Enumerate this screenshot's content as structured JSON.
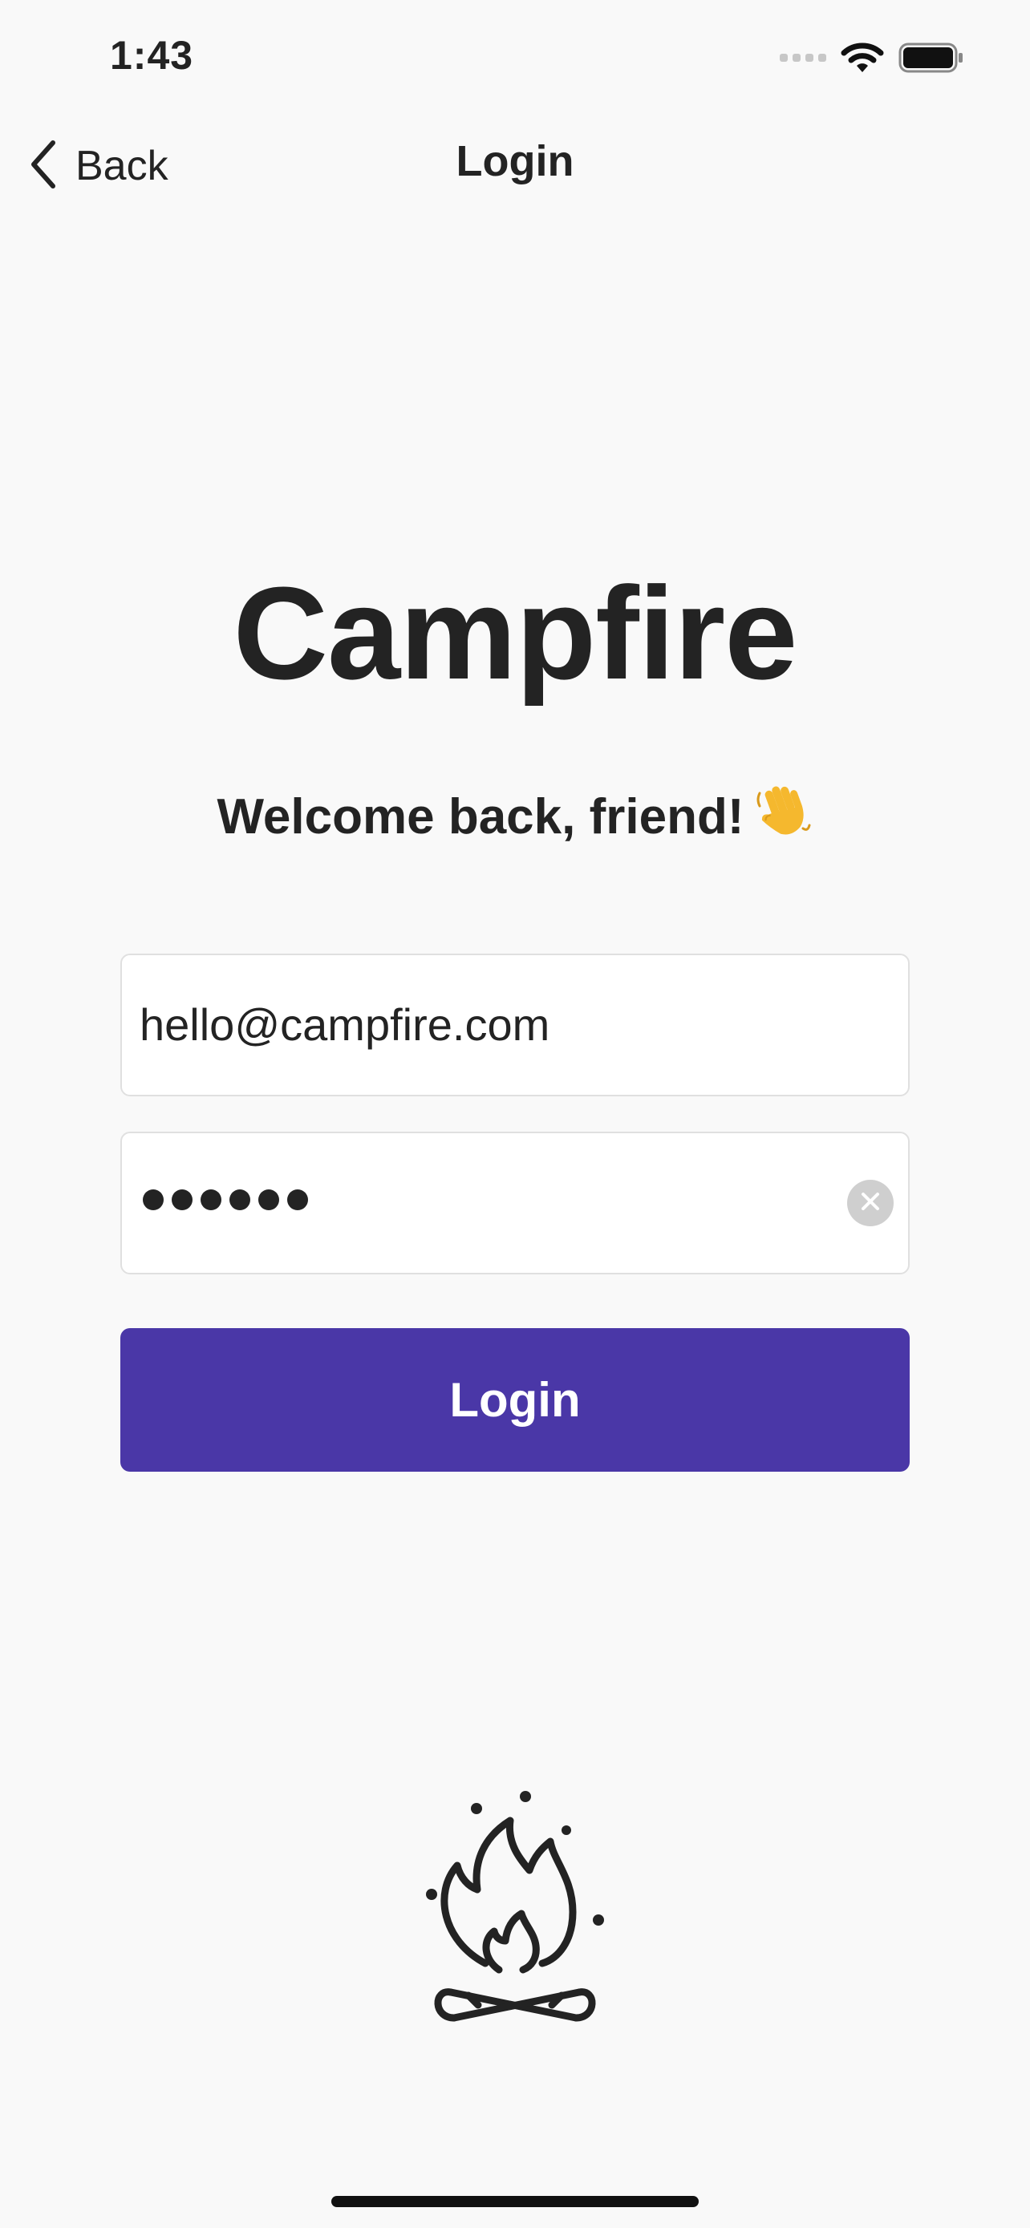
{
  "status_bar": {
    "time": "1:43",
    "icons": [
      "cellular-signal-icon",
      "wifi-icon",
      "battery-icon"
    ]
  },
  "nav": {
    "back_label": "Back",
    "title": "Login"
  },
  "app": {
    "name": "Campfire",
    "welcome": "Welcome back, friend!",
    "welcome_emoji": "waving-hand-icon"
  },
  "form": {
    "email_value": "hello@campfire.com",
    "password_masked_length": 6,
    "login_label": "Login"
  },
  "colors": {
    "accent": "#4a37a7",
    "background": "#f9f9f9",
    "text": "#232323"
  },
  "illustration": "campfire-icon"
}
